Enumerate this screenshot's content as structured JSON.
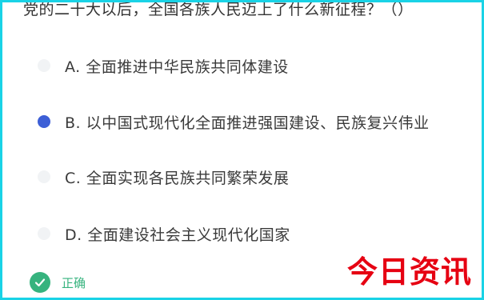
{
  "question": {
    "text": "党的二十大以后，全国各族人民迈上了什么新征程？（）"
  },
  "options": [
    {
      "label": "A. 全面推进中华民族共同体建设",
      "selected": false
    },
    {
      "label": "B. 以中国式现代化全面推进强国建设、民族复兴伟业",
      "selected": true
    },
    {
      "label": "C. 全面实现各民族共同繁荣发展",
      "selected": false
    },
    {
      "label": "D. 全面建设社会主义现代化国家",
      "selected": false
    }
  ],
  "result": {
    "label": "正确",
    "icon": "check-circle-icon"
  },
  "watermark": {
    "text": "今日资讯"
  },
  "colors": {
    "selected": "#3d5fd6",
    "correct": "#36b37e",
    "watermark": "#e60012",
    "border": "#19d3e6"
  }
}
